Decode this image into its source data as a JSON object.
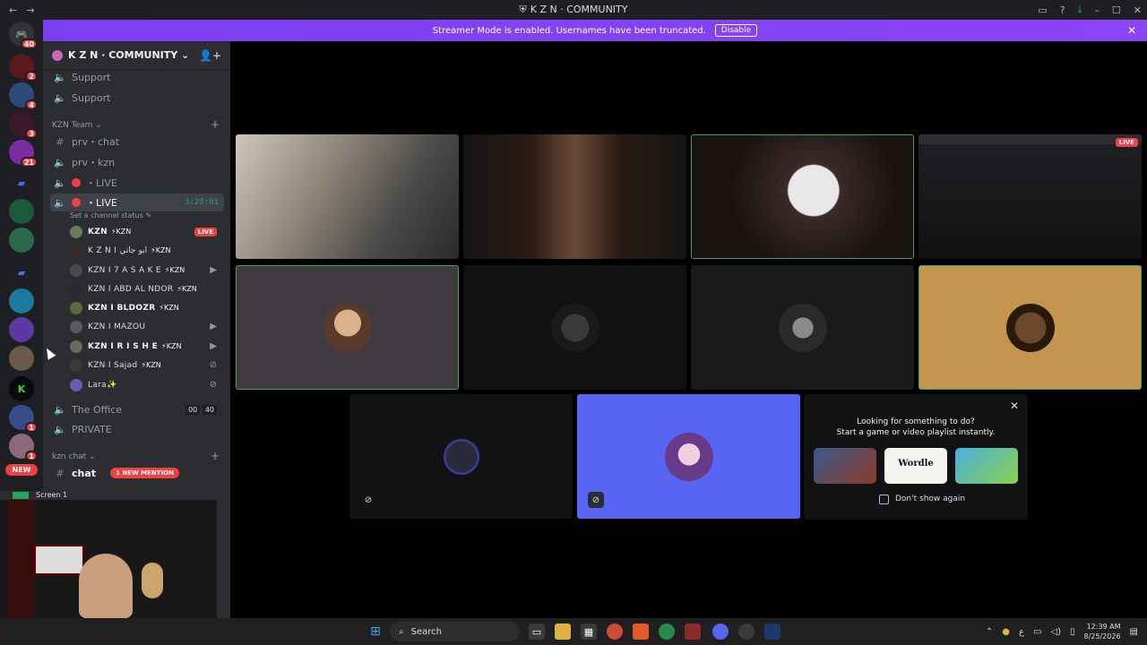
{
  "titlebar": {
    "title": "K Z N · COMMUNITY",
    "back": "←",
    "forward": "→"
  },
  "banner": {
    "message": "Streamer Mode is enabled. Usernames have been truncated.",
    "button": "Disable",
    "close": "✕"
  },
  "servers": [
    {
      "badge": "40"
    },
    {
      "badge": "2"
    },
    {
      "badge": "4"
    },
    {
      "badge": "3"
    },
    {
      "badge": "21"
    },
    {
      "badge": ""
    },
    {
      "badge": ""
    },
    {
      "badge": ""
    },
    {
      "badge": ""
    },
    {
      "badge": ""
    },
    {
      "badge": ""
    },
    {
      "badge": ""
    },
    {
      "badge": ""
    },
    {
      "badge": "1"
    },
    {
      "badge": "1"
    }
  ],
  "servers_new": "NEW",
  "guild": {
    "name": "K Z N · COMMUNITY ⌄"
  },
  "channels": {
    "support1": "Support",
    "support2": "Support",
    "cat_team": "KZN Team ⌄",
    "prv_chat": "prv・chat",
    "prv_kzn": "prv・kzn",
    "live1": "・LIVE",
    "live2": "・LIVE",
    "live2_time": "3:28:01",
    "status": "Set a channel status ✎",
    "office": "The Office",
    "office_a": "00",
    "office_b": "40",
    "private": "PRIVATE",
    "cat_chat": "kzn chat ⌄",
    "chat": "chat",
    "mention": "1 NEW MENTION"
  },
  "members": [
    {
      "name": "KZN",
      "tag": "⚡KZN",
      "live": "LIVE"
    },
    {
      "name": "K Z N I ابو جاتي",
      "tag": "⚡KZN"
    },
    {
      "name": "KZN I 7 A S A K E",
      "tag": "⚡KZN"
    },
    {
      "name": "KZN I ABD AL NDOR",
      "tag": "⚡KZN"
    },
    {
      "name": "KZN I BLDOZR",
      "tag": "⚡KZN"
    },
    {
      "name": "KZN I MAZOU",
      "tag": ""
    },
    {
      "name": "KZN I R I S H E",
      "tag": "⚡KZN"
    },
    {
      "name": "KZN I Sajad",
      "tag": "⚡KZN"
    },
    {
      "name": "Lara✨",
      "tag": ""
    }
  ],
  "webcam": {
    "title": "Screen 1"
  },
  "stage": {
    "live_badge": "LIVE"
  },
  "suggest": {
    "line1": "Looking for something to do?",
    "line2": "Start a game or video playlist instantly.",
    "game2": "Wordle",
    "dont_show": "Don't show again",
    "close": "✕"
  },
  "taskbar": {
    "search": "Search",
    "time": "12:39 AM",
    "date": "8/25/2026",
    "lang": "ع"
  },
  "colors": {
    "accent": "#5865f2",
    "banner": "#8b45f6",
    "live": "#f23f43",
    "online": "#23a55a"
  }
}
